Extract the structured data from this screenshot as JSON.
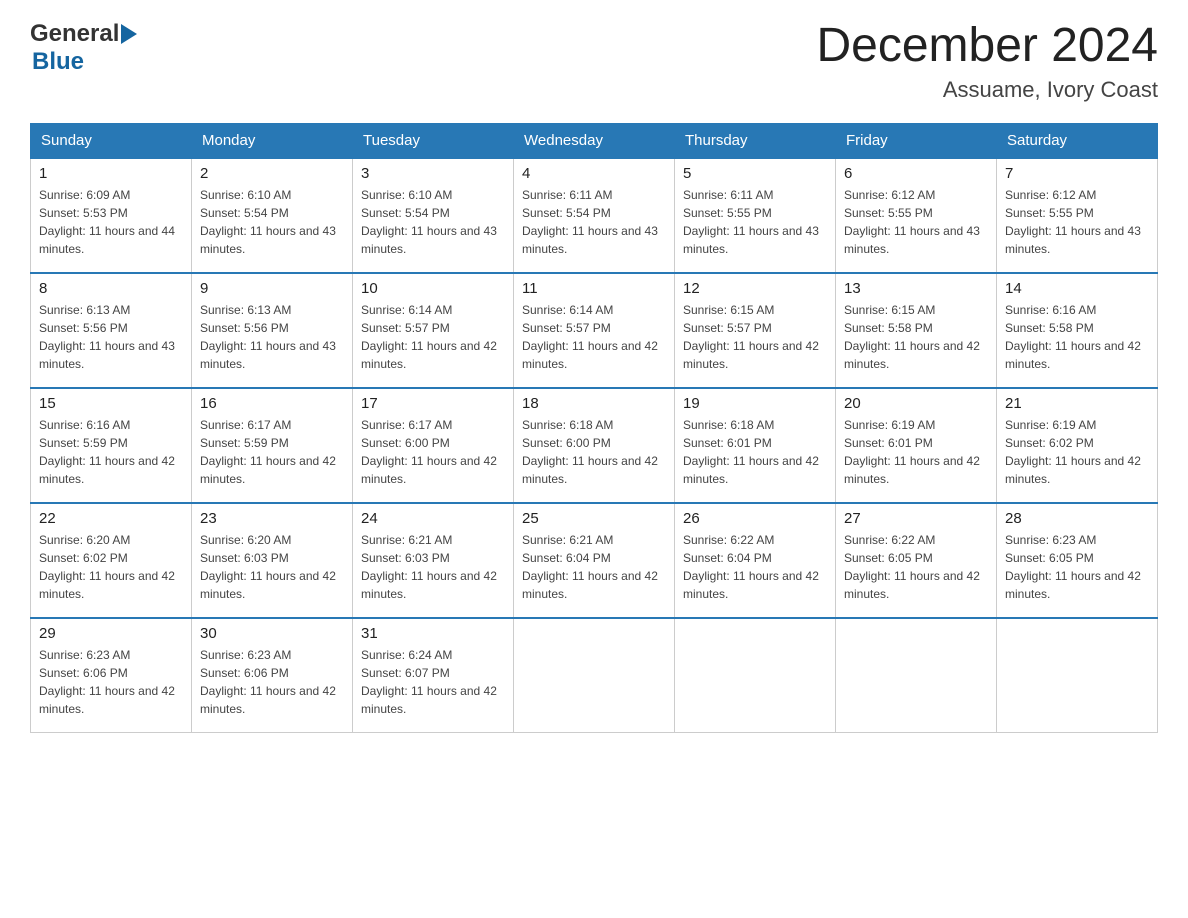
{
  "header": {
    "logo": {
      "general": "General",
      "blue": "Blue"
    },
    "title": "December 2024",
    "location": "Assuame, Ivory Coast"
  },
  "weekdays": [
    "Sunday",
    "Monday",
    "Tuesday",
    "Wednesday",
    "Thursday",
    "Friday",
    "Saturday"
  ],
  "weeks": [
    [
      {
        "day": "1",
        "sunrise": "Sunrise: 6:09 AM",
        "sunset": "Sunset: 5:53 PM",
        "daylight": "Daylight: 11 hours and 44 minutes."
      },
      {
        "day": "2",
        "sunrise": "Sunrise: 6:10 AM",
        "sunset": "Sunset: 5:54 PM",
        "daylight": "Daylight: 11 hours and 43 minutes."
      },
      {
        "day": "3",
        "sunrise": "Sunrise: 6:10 AM",
        "sunset": "Sunset: 5:54 PM",
        "daylight": "Daylight: 11 hours and 43 minutes."
      },
      {
        "day": "4",
        "sunrise": "Sunrise: 6:11 AM",
        "sunset": "Sunset: 5:54 PM",
        "daylight": "Daylight: 11 hours and 43 minutes."
      },
      {
        "day": "5",
        "sunrise": "Sunrise: 6:11 AM",
        "sunset": "Sunset: 5:55 PM",
        "daylight": "Daylight: 11 hours and 43 minutes."
      },
      {
        "day": "6",
        "sunrise": "Sunrise: 6:12 AM",
        "sunset": "Sunset: 5:55 PM",
        "daylight": "Daylight: 11 hours and 43 minutes."
      },
      {
        "day": "7",
        "sunrise": "Sunrise: 6:12 AM",
        "sunset": "Sunset: 5:55 PM",
        "daylight": "Daylight: 11 hours and 43 minutes."
      }
    ],
    [
      {
        "day": "8",
        "sunrise": "Sunrise: 6:13 AM",
        "sunset": "Sunset: 5:56 PM",
        "daylight": "Daylight: 11 hours and 43 minutes."
      },
      {
        "day": "9",
        "sunrise": "Sunrise: 6:13 AM",
        "sunset": "Sunset: 5:56 PM",
        "daylight": "Daylight: 11 hours and 43 minutes."
      },
      {
        "day": "10",
        "sunrise": "Sunrise: 6:14 AM",
        "sunset": "Sunset: 5:57 PM",
        "daylight": "Daylight: 11 hours and 42 minutes."
      },
      {
        "day": "11",
        "sunrise": "Sunrise: 6:14 AM",
        "sunset": "Sunset: 5:57 PM",
        "daylight": "Daylight: 11 hours and 42 minutes."
      },
      {
        "day": "12",
        "sunrise": "Sunrise: 6:15 AM",
        "sunset": "Sunset: 5:57 PM",
        "daylight": "Daylight: 11 hours and 42 minutes."
      },
      {
        "day": "13",
        "sunrise": "Sunrise: 6:15 AM",
        "sunset": "Sunset: 5:58 PM",
        "daylight": "Daylight: 11 hours and 42 minutes."
      },
      {
        "day": "14",
        "sunrise": "Sunrise: 6:16 AM",
        "sunset": "Sunset: 5:58 PM",
        "daylight": "Daylight: 11 hours and 42 minutes."
      }
    ],
    [
      {
        "day": "15",
        "sunrise": "Sunrise: 6:16 AM",
        "sunset": "Sunset: 5:59 PM",
        "daylight": "Daylight: 11 hours and 42 minutes."
      },
      {
        "day": "16",
        "sunrise": "Sunrise: 6:17 AM",
        "sunset": "Sunset: 5:59 PM",
        "daylight": "Daylight: 11 hours and 42 minutes."
      },
      {
        "day": "17",
        "sunrise": "Sunrise: 6:17 AM",
        "sunset": "Sunset: 6:00 PM",
        "daylight": "Daylight: 11 hours and 42 minutes."
      },
      {
        "day": "18",
        "sunrise": "Sunrise: 6:18 AM",
        "sunset": "Sunset: 6:00 PM",
        "daylight": "Daylight: 11 hours and 42 minutes."
      },
      {
        "day": "19",
        "sunrise": "Sunrise: 6:18 AM",
        "sunset": "Sunset: 6:01 PM",
        "daylight": "Daylight: 11 hours and 42 minutes."
      },
      {
        "day": "20",
        "sunrise": "Sunrise: 6:19 AM",
        "sunset": "Sunset: 6:01 PM",
        "daylight": "Daylight: 11 hours and 42 minutes."
      },
      {
        "day": "21",
        "sunrise": "Sunrise: 6:19 AM",
        "sunset": "Sunset: 6:02 PM",
        "daylight": "Daylight: 11 hours and 42 minutes."
      }
    ],
    [
      {
        "day": "22",
        "sunrise": "Sunrise: 6:20 AM",
        "sunset": "Sunset: 6:02 PM",
        "daylight": "Daylight: 11 hours and 42 minutes."
      },
      {
        "day": "23",
        "sunrise": "Sunrise: 6:20 AM",
        "sunset": "Sunset: 6:03 PM",
        "daylight": "Daylight: 11 hours and 42 minutes."
      },
      {
        "day": "24",
        "sunrise": "Sunrise: 6:21 AM",
        "sunset": "Sunset: 6:03 PM",
        "daylight": "Daylight: 11 hours and 42 minutes."
      },
      {
        "day": "25",
        "sunrise": "Sunrise: 6:21 AM",
        "sunset": "Sunset: 6:04 PM",
        "daylight": "Daylight: 11 hours and 42 minutes."
      },
      {
        "day": "26",
        "sunrise": "Sunrise: 6:22 AM",
        "sunset": "Sunset: 6:04 PM",
        "daylight": "Daylight: 11 hours and 42 minutes."
      },
      {
        "day": "27",
        "sunrise": "Sunrise: 6:22 AM",
        "sunset": "Sunset: 6:05 PM",
        "daylight": "Daylight: 11 hours and 42 minutes."
      },
      {
        "day": "28",
        "sunrise": "Sunrise: 6:23 AM",
        "sunset": "Sunset: 6:05 PM",
        "daylight": "Daylight: 11 hours and 42 minutes."
      }
    ],
    [
      {
        "day": "29",
        "sunrise": "Sunrise: 6:23 AM",
        "sunset": "Sunset: 6:06 PM",
        "daylight": "Daylight: 11 hours and 42 minutes."
      },
      {
        "day": "30",
        "sunrise": "Sunrise: 6:23 AM",
        "sunset": "Sunset: 6:06 PM",
        "daylight": "Daylight: 11 hours and 42 minutes."
      },
      {
        "day": "31",
        "sunrise": "Sunrise: 6:24 AM",
        "sunset": "Sunset: 6:07 PM",
        "daylight": "Daylight: 11 hours and 42 minutes."
      },
      null,
      null,
      null,
      null
    ]
  ]
}
